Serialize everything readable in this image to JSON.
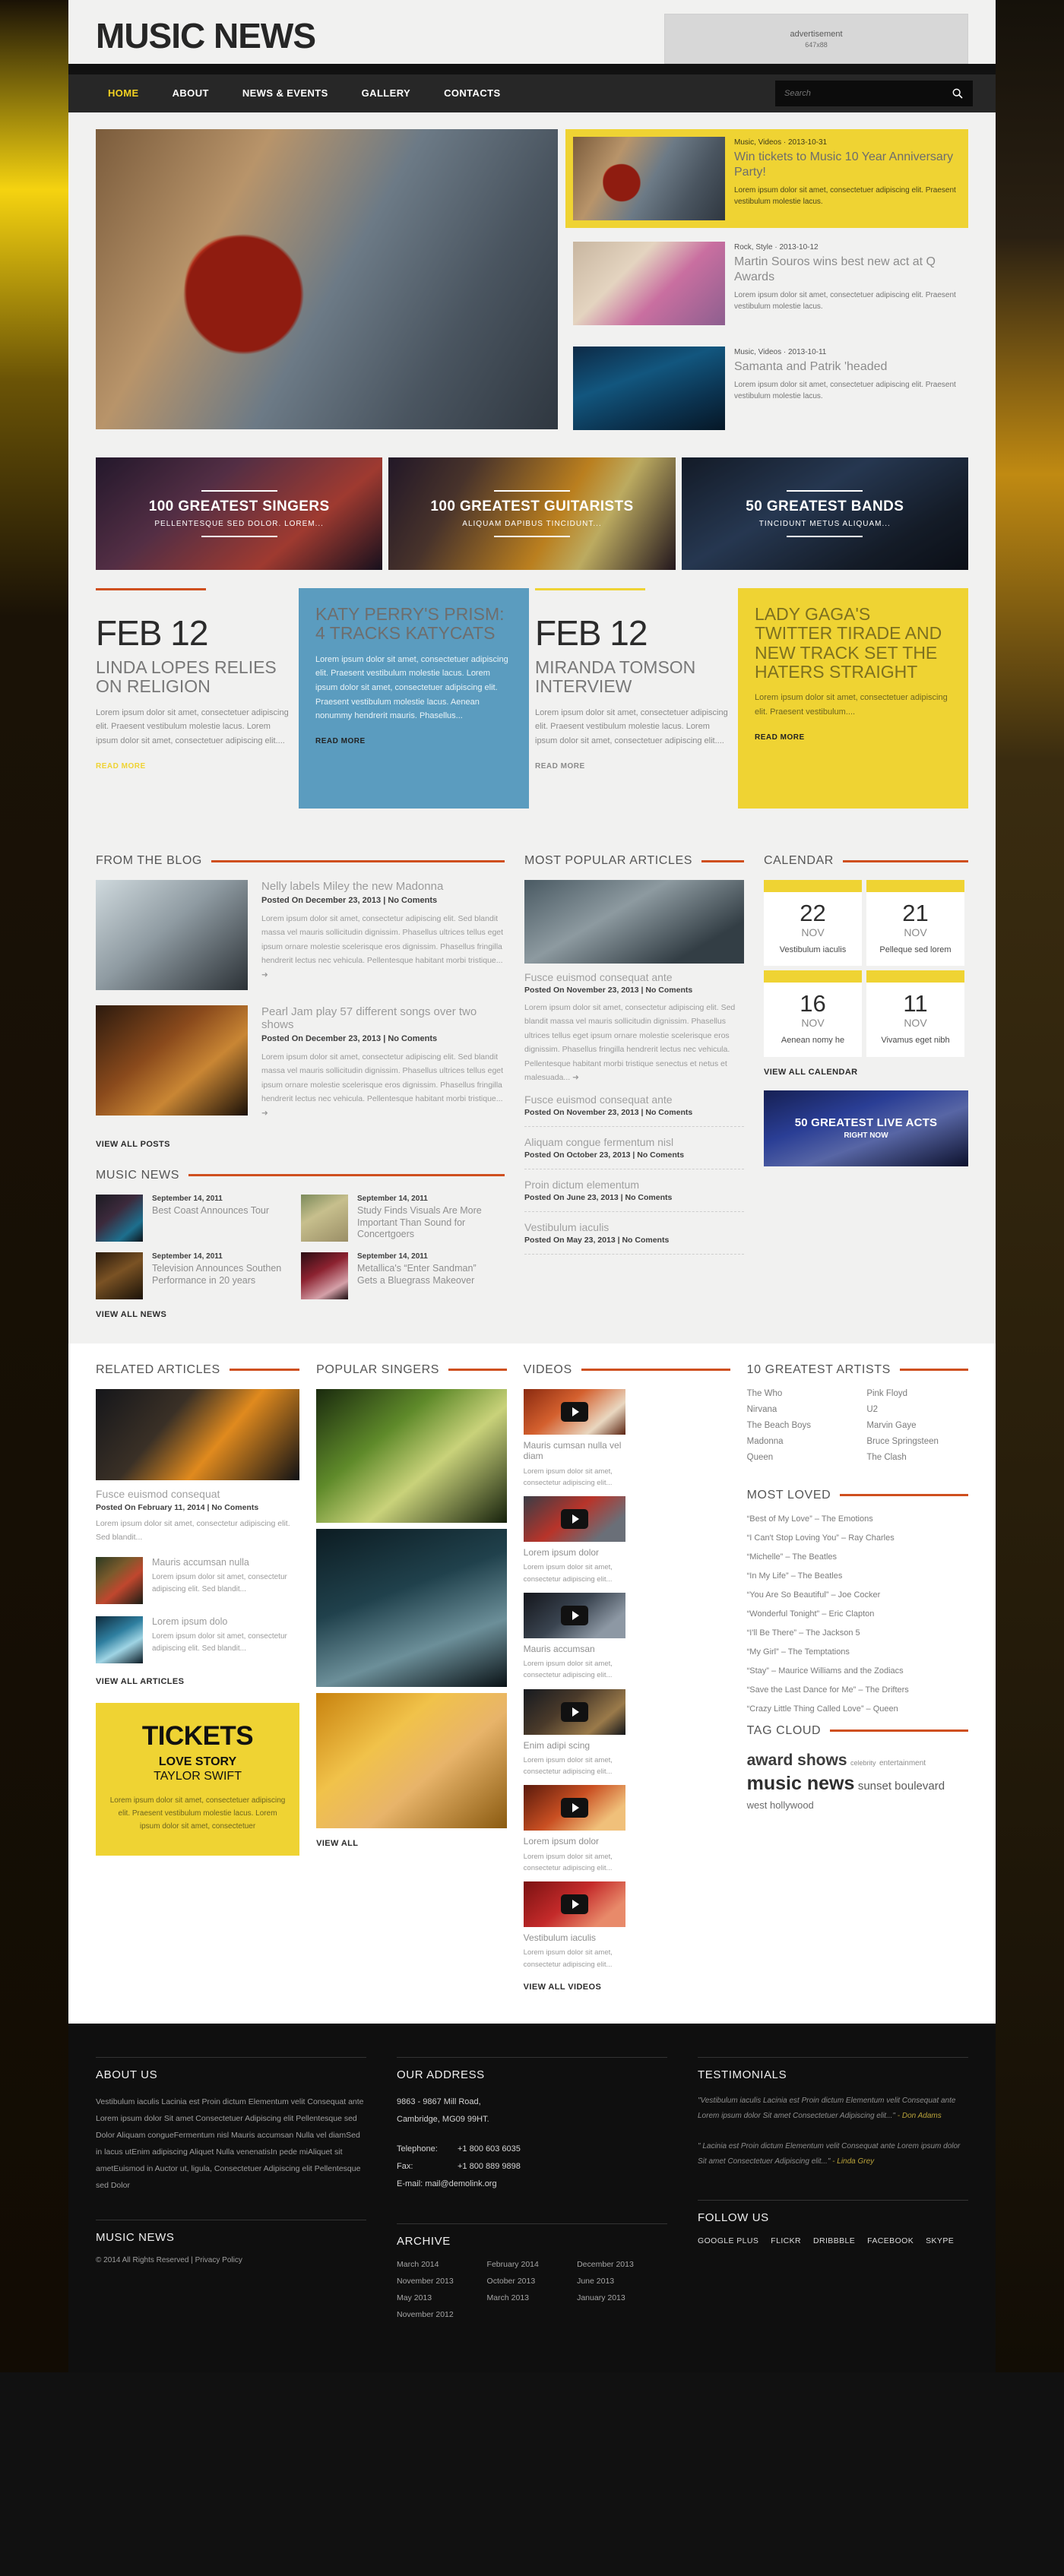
{
  "site": {
    "logo": "MUSIC NEWS"
  },
  "ad": {
    "label": "advertisement",
    "size": "647x88"
  },
  "nav": {
    "items": [
      "HOME",
      "ABOUT",
      "NEWS & EVENTS",
      "GALLERY",
      "CONTACTS"
    ],
    "active": "HOME",
    "search_placeholder": "Search"
  },
  "hero": {
    "side": [
      {
        "meta": "Music, Videos · 2013-10-31",
        "title": "Win tickets to Music 10 Year Anniversary Party!",
        "desc": "Lorem ipsum dolor sit amet, consectetuer adipiscing elit. Praesent vestibulum molestie lacus."
      },
      {
        "meta": "Rock, Style · 2013-10-12",
        "title": "Martin Souros wins best new act at Q Awards",
        "desc": "Lorem ipsum dolor sit amet, consectetuer adipiscing elit. Praesent vestibulum molestie lacus."
      },
      {
        "meta": "Music, Videos · 2013-10-11",
        "title": "Samanta and Patrik 'headed",
        "desc": "Lorem ipsum dolor sit amet, consectetuer adipiscing elit. Praesent vestibulum molestie lacus."
      }
    ]
  },
  "banners": [
    {
      "title": "100 GREATEST SINGERS",
      "sub": "PELLENTESQUE SED DOLOR. LOREM..."
    },
    {
      "title": "100 GREATEST GUITARISTS",
      "sub": "ALIQUAM DAPIBUS TINCIDUNT..."
    },
    {
      "title": "50 GREATEST BANDS",
      "sub": "TINCIDUNT METUS ALIQUAM..."
    }
  ],
  "cards": [
    {
      "date": "FEB 12",
      "title": "LINDA LOPES RELIES ON RELIGION",
      "text": "Lorem ipsum dolor sit amet, consectetuer adipiscing elit. Praesent vestibulum molestie lacus. Lorem ipsum dolor sit amet, consectetuer adipiscing elit....",
      "read_more": "READ MORE"
    },
    {
      "title": "KATY PERRY'S PRISM: 4 TRACKS KATYCATS",
      "text": "Lorem ipsum dolor sit amet, consectetuer adipiscing elit. Praesent vestibulum molestie lacus. Lorem ipsum dolor sit amet, consectetuer adipiscing elit. Praesent vestibulum molestie lacus. Aenean nonummy hendrerit mauris. Phasellus...",
      "read_more": "READ MORE"
    },
    {
      "date": "FEB 12",
      "title": "MIRANDA TOMSON INTERVIEW",
      "text": "Lorem ipsum dolor sit amet, consectetuer adipiscing elit. Praesent vestibulum molestie lacus. Lorem ipsum dolor sit amet, consectetuer adipiscing elit....",
      "read_more": "READ MORE"
    },
    {
      "title": "LADY GAGA'S TWITTER TIRADE AND NEW TRACK SET THE HATERS STRAIGHT",
      "text": "Lorem ipsum dolor sit amet, consectetuer adipiscing elit. Praesent vestibulum....",
      "read_more": "READ MORE"
    }
  ],
  "blog": {
    "heading": "FROM THE BLOG",
    "view_all": "VIEW ALL POSTS",
    "posts": [
      {
        "title": "Nelly labels Miley the new Madonna",
        "meta": "Posted On December 23, 2013  |  No Coments",
        "text": "Lorem ipsum dolor sit amet, consectetur adipiscing elit. Sed blandit massa vel mauris sollicitudin dignissim. Phasellus ultrices tellus eget ipsum ornare molestie scelerisque eros dignissim. Phasellus fringilla hendrerit lectus nec vehicula. Pellentesque habitant morbi tristique... ➜"
      },
      {
        "title": "Pearl Jam play 57 different songs over two shows",
        "meta": "Posted On December 23, 2013  |  No Coments",
        "text": "Lorem ipsum dolor sit amet, consectetur adipiscing elit. Sed blandit massa vel mauris sollicitudin dignissim. Phasellus ultrices tellus eget ipsum ornare molestie scelerisque eros dignissim. Phasellus fringilla hendrerit lectus nec vehicula. Pellentesque habitant morbi tristique... ➜"
      }
    ]
  },
  "music_news": {
    "heading": "MUSIC NEWS",
    "view_all": "VIEW ALL NEWS",
    "items": [
      {
        "date": "September 14, 2011",
        "title": "Best Coast Announces Tour"
      },
      {
        "date": "September 14, 2011",
        "title": "Study Finds Visuals Are More Important Than Sound for Concertgoers"
      },
      {
        "date": "September 14, 2011",
        "title": "Television Announces Southen Performance in 20 years"
      },
      {
        "date": "September 14, 2011",
        "title": "Metallica's “Enter Sandman” Gets a Bluegrass Makeover"
      }
    ]
  },
  "popular": {
    "heading": "MOST POPULAR ARTICLES",
    "lead": {
      "title": "Fusce euismod consequat ante",
      "meta": "Posted On November 23, 2013  |  No Coments",
      "text": "Lorem ipsum dolor sit amet, consectetur adipiscing elit. Sed blandit massa vel mauris sollicitudin dignissim. Phasellus ultrices tellus eget ipsum ornare molestie scelerisque eros dignissim. Phasellus fringilla hendrerit lectus nec vehicula. Pellentesque habitant morbi tristique senectus et netus et malesuada... ➜"
    },
    "rows": [
      {
        "title": "Fusce euismod consequat ante",
        "meta": "Posted On November 23, 2013  |  No Coments"
      },
      {
        "title": "Aliquam congue fermentum nisl",
        "meta": "Posted On October 23, 2013  |  No Coments"
      },
      {
        "title": "Proin dictum elementum",
        "meta": "Posted On June 23, 2013  |  No Coments"
      },
      {
        "title": "Vestibulum iaculis",
        "meta": "Posted On May 23, 2013  |  No Coments"
      }
    ]
  },
  "calendar": {
    "heading": "CALENDAR",
    "view_all": "VIEW ALL CALENDAR",
    "events": [
      {
        "day": "22",
        "month": "NOV",
        "title": "Vestibulum iaculis"
      },
      {
        "day": "21",
        "month": "NOV",
        "title": "Pelleque sed lorem"
      },
      {
        "day": "16",
        "month": "NOV",
        "title": "Aenean nomy he"
      },
      {
        "day": "11",
        "month": "NOV",
        "title": "Vivamus eget nibh"
      }
    ],
    "promo": {
      "title": "50 GREATEST LIVE ACTS",
      "sub": "RIGHT NOW"
    }
  },
  "related": {
    "heading": "RELATED ARTICLES",
    "view_all": "VIEW ALL ARTICLES",
    "lead": {
      "title": "Fusce euismod consequat",
      "meta": "Posted On February 11, 2014  |  No Coments",
      "text": "Lorem ipsum dolor sit amet, consectetur adipiscing elit. Sed blandit..."
    },
    "minis": [
      {
        "title": "Mauris accumsan nulla",
        "text": "Lorem ipsum dolor sit amet, consectetur adipiscing elit. Sed blandit..."
      },
      {
        "title": "Lorem ipsum dolo",
        "text": "Lorem ipsum dolor sit amet, consectetur adipiscing elit. Sed blandit..."
      }
    ],
    "ticket": {
      "heading": "TICKETS",
      "line1": "LOVE STORY",
      "line2": "TAYLOR SWIFT",
      "text": "Lorem ipsum dolor sit amet, consectetuer adipiscing elit. Praesent vestibulum molestie lacus. Lorem ipsum dolor sit amet, consectetuer"
    }
  },
  "singers": {
    "heading": "POPULAR SINGERS",
    "view_all": "VIEW ALL"
  },
  "videos": {
    "heading": "VIDEOS",
    "view_all": "VIEW ALL VIDEOS",
    "items": [
      {
        "title": "Mauris cumsan nulla vel diam",
        "text": "Lorem ipsum dolor sit amet, consectetur adipiscing elit..."
      },
      {
        "title": "Lorem ipsum dolor",
        "text": "Lorem ipsum dolor sit amet, consectetur adipiscing elit..."
      },
      {
        "title": "Mauris accumsan",
        "text": "Lorem ipsum dolor sit amet, consectetur adipiscing elit..."
      },
      {
        "title": "Enim adipi scing",
        "text": "Lorem ipsum dolor sit amet, consectetur adipiscing elit..."
      },
      {
        "title": "Lorem ipsum dolor",
        "text": "Lorem ipsum dolor sit amet, consectetur adipiscing elit..."
      },
      {
        "title": "Vestibulum iaculis",
        "text": "Lorem ipsum dolor sit amet, consectetur adipiscing elit..."
      }
    ]
  },
  "artists": {
    "heading": "10 GREATEST ARTISTS",
    "left": [
      "The Who",
      "Nirvana",
      "The Beach Boys",
      "Madonna",
      "Queen"
    ],
    "right": [
      "Pink Floyd",
      "U2",
      "Marvin Gaye",
      "Bruce Springsteen",
      "The Clash"
    ]
  },
  "most_loved": {
    "heading": "MOST LOVED",
    "items": [
      "“Best of My Love” – The Emotions",
      "“I Can't Stop Loving You” – Ray Charles",
      "“Michelle” – The Beatles",
      "“In My Life” – The Beatles",
      "“You Are So Beautiful” – Joe Cocker",
      "“Wonderful Tonight” – Eric Clapton",
      "“I'll Be There” – The Jackson 5",
      "“My Girl” – The Temptations",
      "“Stay” – Maurice Williams and the Zodiacs",
      "“Save the Last Dance for Me” – The Drifters",
      "“Crazy Little Thing Called Love” – Queen"
    ]
  },
  "tag_cloud": {
    "heading": "TAG CLOUD",
    "tags": [
      "award shows",
      "celebrity",
      "entertainment",
      "music news",
      "sunset boulevard",
      "west hollywood"
    ]
  },
  "footer": {
    "about": {
      "heading": "ABOUT US",
      "text": "Vestibulum iaculis Lacinia est Proin dictum Elementum velit Consequat ante Lorem ipsum dolor Sit amet Consectetuer Adipiscing elit Pellentesque sed Dolor Aliquam congueFermentum nisl Mauris accumsan Nulla vel diamSed in lacus utEnim adipiscing Aliquet Nulla venenatisIn pede miAliquet sit ametEuismod in Auctor ut, ligula, Consectetuer Adipiscing elit Pellentesque sed Dolor"
    },
    "brand": {
      "heading": "MUSIC NEWS",
      "copy": "© 2014 All Rights Reserved | Privacy Policy"
    },
    "address": {
      "heading": "OUR ADDRESS",
      "line1": "9863 - 9867 Mill Road,",
      "line2": "Cambridge, MG09 99HT.",
      "telephone_label": "Telephone:",
      "telephone": "+1 800 603 6035",
      "fax_label": "Fax:",
      "fax": "+1 800 889 9898",
      "email": "E-mail: mail@demolink.org"
    },
    "archive": {
      "heading": "ARCHIVE",
      "items": [
        "March 2014",
        "February 2014",
        "December 2013",
        "November 2013",
        "October 2013",
        "June 2013",
        "May 2013",
        "March 2013",
        "January 2013",
        "November 2012"
      ]
    },
    "testimonials": {
      "heading": "TESTIMONIALS",
      "items": [
        {
          "quote": "\"Vestibulum iaculis Lacinia est Proin dictum Elementum velit Consequat ante Lorem ipsum dolor Sit amet Consectetuer Adipiscing elit...\"",
          "author": "- Don Adams"
        },
        {
          "quote": "\" Lacinia est Proin dictum Elementum velit Consequat ante Lorem ipsum dolor Sit amet Consectetuer Adipiscing elit...\"",
          "author": "- Linda Grey"
        }
      ]
    },
    "follow": {
      "heading": "FOLLOW US",
      "links": [
        "GOOGLE PLUS",
        "FLICKR",
        "DRIBBBLE",
        "FACEBOOK",
        "SKYPE"
      ]
    }
  },
  "colors": {
    "accent_yellow": "#efd333",
    "accent_orange": "#cf4f1e",
    "accent_blue": "#5b9cbf",
    "nav_dark": "#272727"
  }
}
